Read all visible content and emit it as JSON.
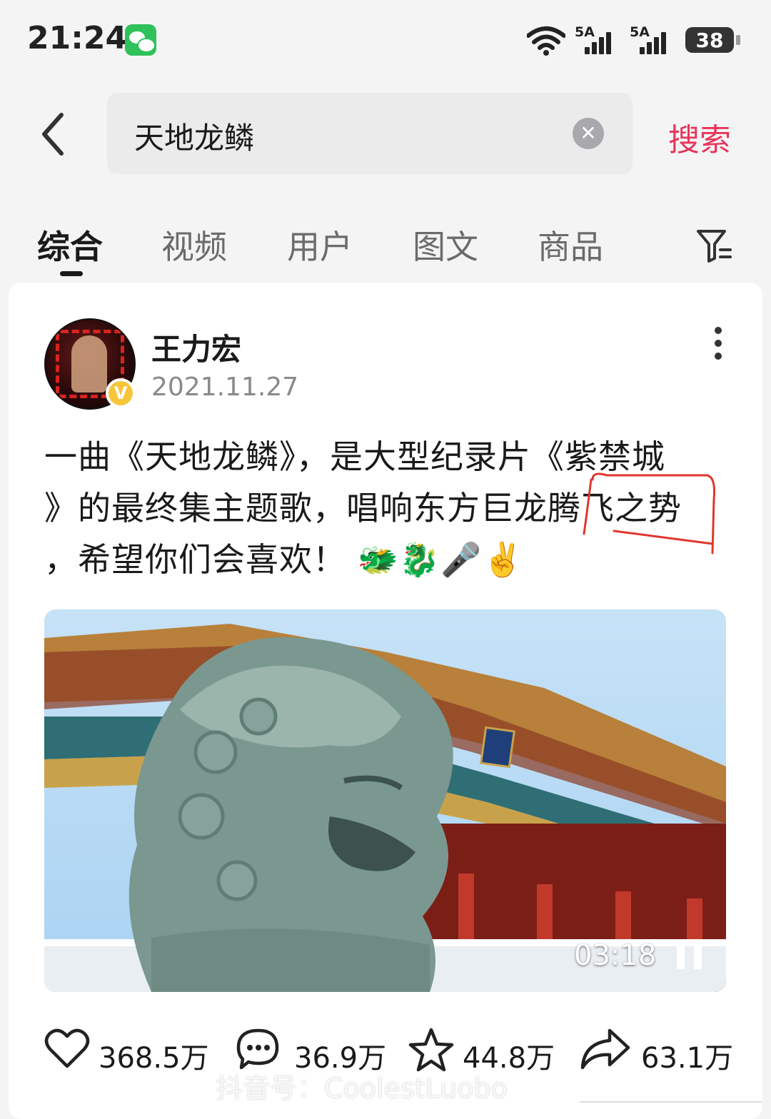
{
  "status_bar": {
    "time": "21:24",
    "signal1_label": "5A",
    "signal2_label": "5A",
    "battery": "38"
  },
  "search": {
    "query": "天地龙鳞",
    "button_label": "搜索"
  },
  "tabs": [
    {
      "label": "综合",
      "active": true
    },
    {
      "label": "视频",
      "active": false
    },
    {
      "label": "用户",
      "active": false
    },
    {
      "label": "图文",
      "active": false
    },
    {
      "label": "商品",
      "active": false
    }
  ],
  "post": {
    "author": "王力宏",
    "date": "2021.11.27",
    "text_line1": "一曲《天地龙鳞》，是大型纪录片《紫禁城",
    "text_line2": "》的最终集主题歌，唱响东方巨龙腾飞之势",
    "text_line3": "，希望你们会喜欢！ 🐲🐉🎤✌️",
    "video_duration": "03:18",
    "annotation_color": "#e0362c"
  },
  "actions": {
    "likes": "368.5万",
    "comments": "36.9万",
    "favorites": "44.8万",
    "shares": "63.1万"
  },
  "watermark": "抖音号：CoolestLuobo",
  "colors": {
    "accent": "#e8355a",
    "wechat": "#2fc25b"
  }
}
